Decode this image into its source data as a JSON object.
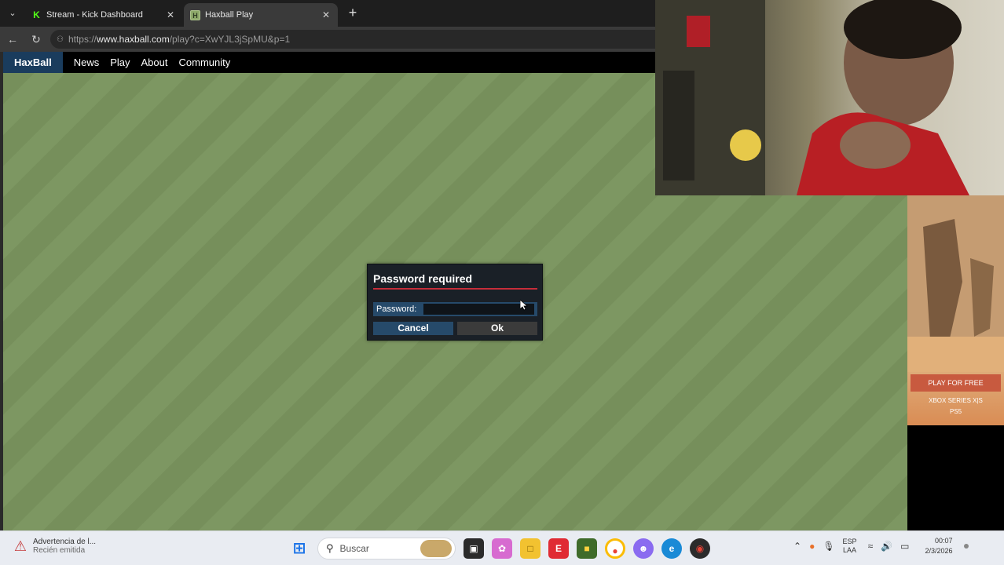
{
  "browser": {
    "tabs": [
      {
        "title": "Stream - Kick Dashboard",
        "favicon": "kick-icon"
      },
      {
        "title": "Haxball Play",
        "favicon": "haxball-icon"
      }
    ],
    "url_prefix": "https://",
    "url_host": "www.haxball.com",
    "url_path": "/play?c=XwYJL3jSpMU&p=1"
  },
  "site_nav": {
    "logo": "HaxBall",
    "links": [
      "News",
      "Play",
      "About",
      "Community"
    ]
  },
  "dialog": {
    "title": "Password required",
    "password_label": "Password:",
    "password_value": "",
    "cancel_label": "Cancel",
    "ok_label": "Ok"
  },
  "ad": {
    "cta": "PLAY FOR FREE",
    "platform1": "XBOX SERIES X|S",
    "platform2": "PS5"
  },
  "taskbar": {
    "notification_title": "Advertencia de l...",
    "notification_sub": "Recién emitida",
    "search_placeholder": "Buscar",
    "lang_1": "ESP",
    "lang_2": "LAA",
    "time": "00:07",
    "date": "2/3/2026"
  },
  "colors": {
    "field_stripe_1": "#768f5b",
    "field_stripe_2": "#7d9762",
    "dialog_bg": "#1a2027",
    "accent_red": "#c62d3a",
    "button_blue": "#264a6a"
  }
}
